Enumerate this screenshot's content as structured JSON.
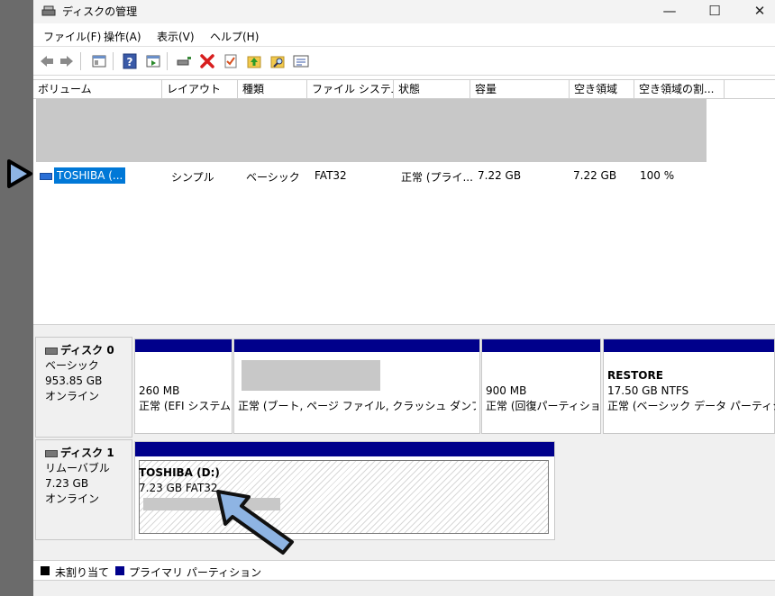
{
  "window": {
    "title": "ディスクの管理",
    "minimize_label": "—",
    "maximize_label": "☐",
    "close_label": "✕"
  },
  "menu": [
    "ファイル(F)",
    "操作(A)",
    "表示(V)",
    "ヘルプ(H)"
  ],
  "toolbar": {
    "icons": [
      "back-icon",
      "forward-icon",
      "console-tree-icon",
      "help-icon",
      "action-pane-icon",
      "connect-drive-icon",
      "delete-icon",
      "check-icon",
      "folder-up-icon",
      "search-folder-icon",
      "properties-icon"
    ]
  },
  "volume_list": {
    "columns": [
      "ボリューム",
      "レイアウト",
      "種類",
      "ファイル システム",
      "状態",
      "容量",
      "空き領域",
      "空き領域の割..."
    ],
    "selected_row": {
      "volume": "TOSHIBA (...",
      "layout": "シンプル",
      "type": "ベーシック",
      "filesystem": "FAT32",
      "status": "正常 (プライ...",
      "capacity": "7.22 GB",
      "free": "7.22 GB",
      "free_pct": "100 %"
    }
  },
  "disks": [
    {
      "name": "ディスク 0",
      "type": "ベーシック",
      "size": "953.85 GB",
      "state": "オンライン",
      "partitions": [
        {
          "title": "",
          "line1": "260 MB",
          "line2": "正常 (EFI システム"
        },
        {
          "title": "",
          "line1": "",
          "line2": "正常 (ブート, ページ ファイル, クラッシュ ダンプ, ベーシ"
        },
        {
          "title": "",
          "line1": "900 MB",
          "line2": "正常 (回復パーティショ"
        },
        {
          "title": "RESTORE",
          "line1": "17.50 GB NTFS",
          "line2": "正常 (ベーシック データ パーティション"
        }
      ]
    },
    {
      "name": "ディスク 1",
      "type": "リムーバブル",
      "size": "7.23 GB",
      "state": "オンライン",
      "partitions": [
        {
          "title": "TOSHIBA  (D:)",
          "line1": "7.23 GB FAT32",
          "line2": ""
        }
      ]
    }
  ],
  "legend": {
    "unallocated": "未割り当て",
    "primary": "プライマリ パーティション",
    "unallocated_color": "#000000",
    "primary_color": "#00008b"
  },
  "colors": {
    "selection": "#0078d7",
    "partition_bar": "#00008b",
    "annotation_arrow": "#8eb4e3"
  }
}
